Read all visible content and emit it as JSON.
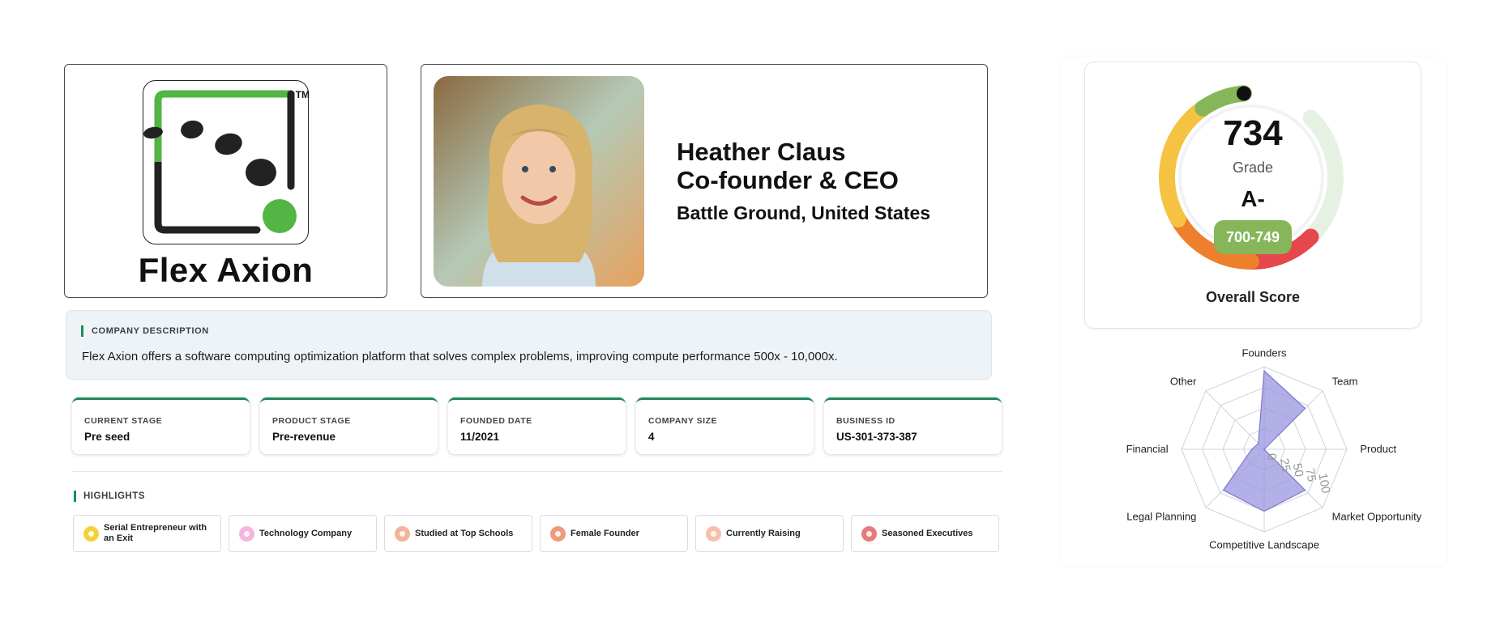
{
  "company": {
    "name": "Flex Axion",
    "logo_mark": "TM"
  },
  "founder": {
    "name": "Heather Claus",
    "role": "Co-founder & CEO",
    "location": "Battle Ground, United States"
  },
  "description": {
    "label": "COMPANY DESCRIPTION",
    "text": "Flex Axion offers a software computing optimization platform that solves complex problems, improving compute performance 500x - 10,000x."
  },
  "stats": [
    {
      "label": "CURRENT STAGE",
      "value": "Pre seed"
    },
    {
      "label": "PRODUCT STAGE",
      "value": "Pre-revenue"
    },
    {
      "label": "FOUNDED DATE",
      "value": "11/2021"
    },
    {
      "label": "COMPANY SIZE",
      "value": "4"
    },
    {
      "label": "BUSINESS ID",
      "value": "US-301-373-387"
    }
  ],
  "highlights": {
    "title": "HIGHLIGHTS",
    "items": [
      {
        "label": "Serial Entrepreneur with an Exit",
        "icon": "lightbulb-icon",
        "color": "#f2d23a"
      },
      {
        "label": "Technology Company",
        "icon": "gear-icon",
        "color": "#f4b6dc"
      },
      {
        "label": "Studied at Top Schools",
        "icon": "graduation-cap-icon",
        "color": "#f2b49a"
      },
      {
        "label": "Female Founder",
        "icon": "female-icon",
        "color": "#ee9a7e"
      },
      {
        "label": "Currently Raising",
        "icon": "dollar-icon",
        "color": "#f6c0ac"
      },
      {
        "label": "Seasoned Executives",
        "icon": "user-icon",
        "color": "#e57b7b"
      }
    ]
  },
  "score": {
    "value": "734",
    "grade_label": "Grade",
    "grade": "A-",
    "range": "700-749",
    "caption": "Overall Score",
    "colors": {
      "green": "#86b55a",
      "yellow": "#f5c242",
      "orange": "#ee7f2d",
      "red": "#e5474c",
      "track": "#e6f1e3"
    }
  },
  "chart_data": {
    "type": "radar",
    "axes": [
      "Founders",
      "Team",
      "Product",
      "Market Opportunity",
      "Competitive Landscape",
      "Legal Planning",
      "Financial",
      "Other"
    ],
    "ticks": [
      "0",
      "25",
      "50",
      "75",
      "100"
    ],
    "range": [
      0,
      100
    ],
    "values": [
      95,
      70,
      0,
      70,
      75,
      70,
      15,
      10
    ],
    "fill_color": "#9a96e0"
  }
}
